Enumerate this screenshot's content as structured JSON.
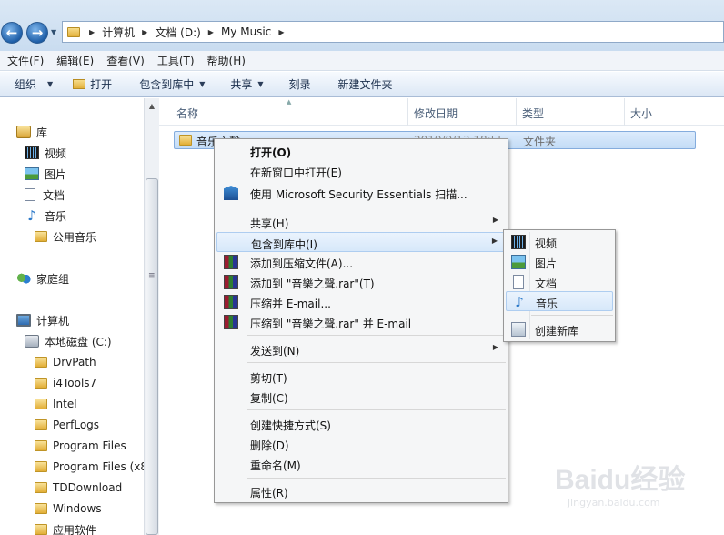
{
  "address_bar": {
    "crumbs": [
      "计算机",
      "文档 (D:)",
      "My Music"
    ]
  },
  "menubar": {
    "items": [
      "文件(F)",
      "编辑(E)",
      "查看(V)",
      "工具(T)",
      "帮助(H)"
    ]
  },
  "commandbar": {
    "organize": "组织",
    "open": "打开",
    "include_in_library": "包含到库中",
    "share": "共享",
    "burn": "刻录",
    "new_folder": "新建文件夹"
  },
  "navpane": {
    "libraries": "库",
    "videos": "视频",
    "pictures": "图片",
    "documents": "文档",
    "music": "音乐",
    "public_music": "公用音乐",
    "homegroup": "家庭组",
    "computer": "计算机",
    "local_disk": "本地磁盘 (C:)",
    "folders": [
      "DrvPath",
      "i4Tools7",
      "Intel",
      "PerfLogs",
      "Program Files",
      "Program Files (x8",
      "TDDownload",
      "Windows",
      "应用软件"
    ]
  },
  "columns": {
    "name": "名称",
    "date": "修改日期",
    "type": "类型",
    "size": "大小"
  },
  "file": {
    "name": "音乐之聲",
    "date": "2019/9/13 18:55",
    "type": "文件夹"
  },
  "context_menu": {
    "open": "打开(O)",
    "open_new_window": "在新窗口中打开(E)",
    "scan_mse": "使用 Microsoft Security Essentials 扫描...",
    "share": "共享(H)",
    "include_in_library": "包含到库中(I)",
    "add_to_archive": "添加到压缩文件(A)...",
    "add_to_rar": "添加到 \"音樂之聲.rar\"(T)",
    "compress_email": "压缩并 E-mail...",
    "compress_rar_email": "压缩到 \"音樂之聲.rar\" 并 E-mail",
    "send_to": "发送到(N)",
    "cut": "剪切(T)",
    "copy": "复制(C)",
    "create_shortcut": "创建快捷方式(S)",
    "delete": "删除(D)",
    "rename": "重命名(M)",
    "properties": "属性(R)"
  },
  "submenu": {
    "videos": "视频",
    "pictures": "图片",
    "documents": "文档",
    "music": "音乐",
    "new_library": "创建新库"
  },
  "watermark": {
    "main": "Baidu经验",
    "sub": "jingyan.baidu.com"
  }
}
